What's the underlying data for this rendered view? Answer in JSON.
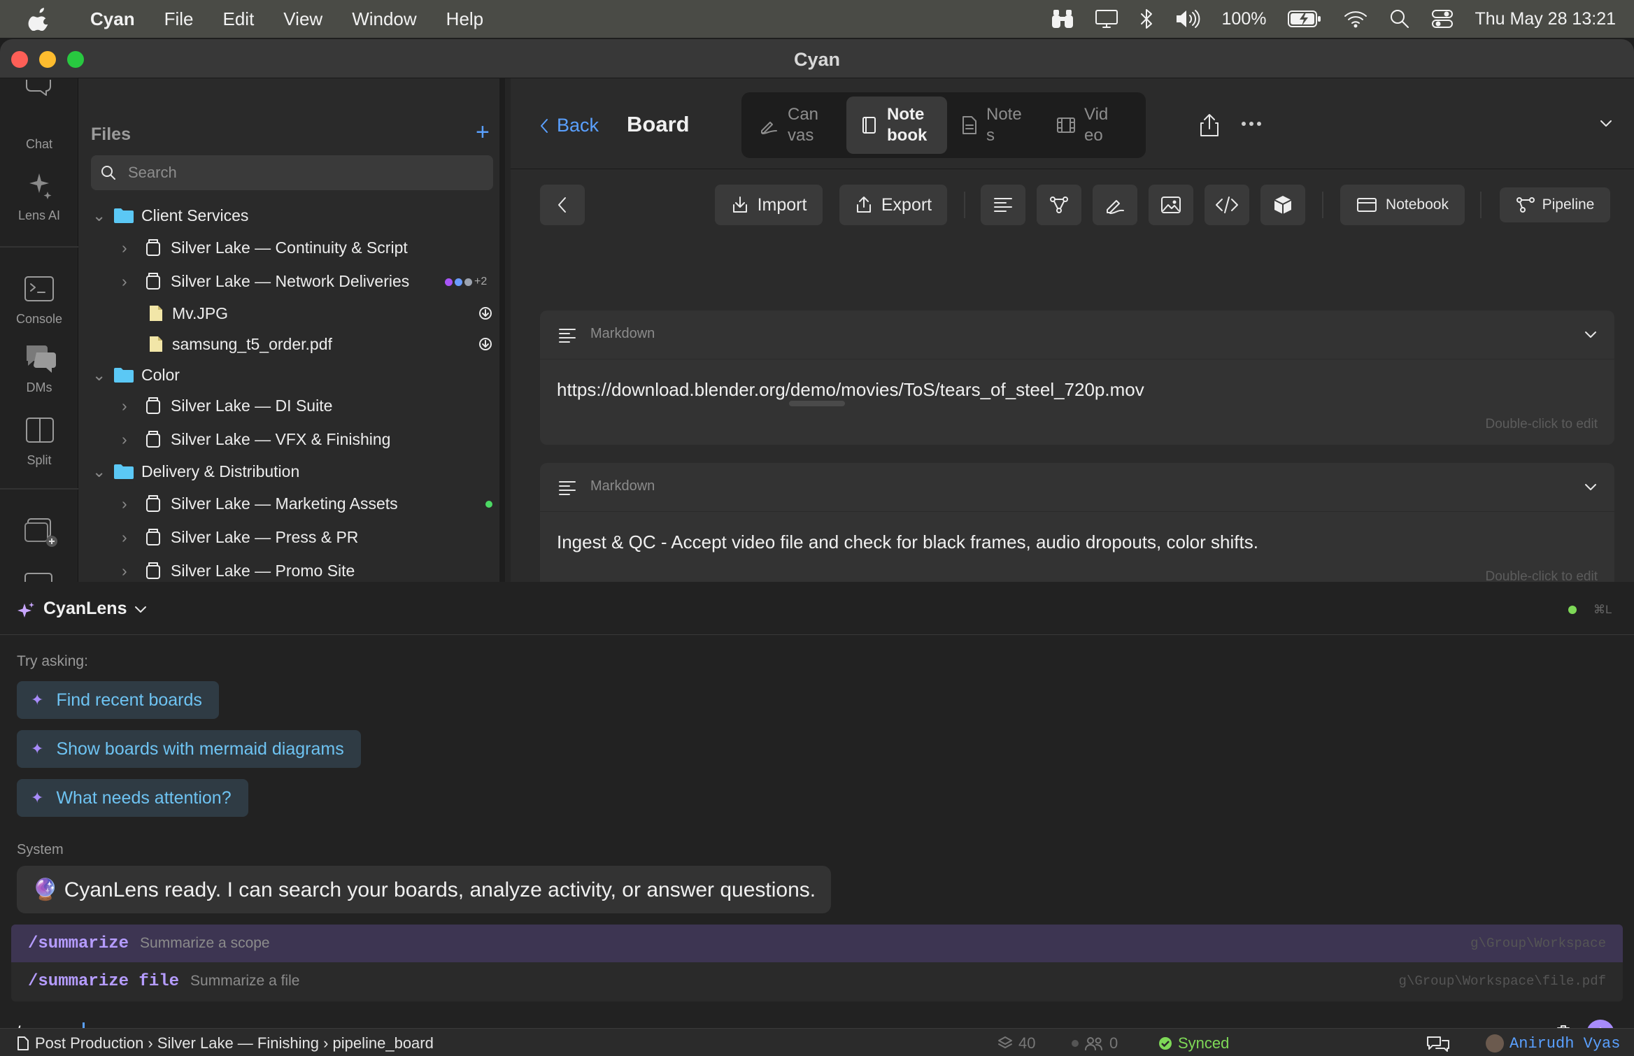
{
  "menubar": {
    "app": "Cyan",
    "items": [
      "File",
      "Edit",
      "View",
      "Window",
      "Help"
    ],
    "battery": "100%",
    "clock": "Thu May 28  13:21"
  },
  "window": {
    "title": "Cyan"
  },
  "rail": {
    "items": [
      "Chat",
      "Lens AI",
      "Console",
      "DMs",
      "Split"
    ]
  },
  "files": {
    "header": "Files",
    "search_placeholder": "Search",
    "groups": [
      {
        "name": "Client Services",
        "items": [
          "Silver Lake — Continuity & Script",
          "Silver Lake — Network Deliveries",
          "Mv.JPG",
          "samsung_t5_order.pdf"
        ]
      },
      {
        "name": "Color",
        "items": [
          "Silver Lake — DI Suite",
          "Silver Lake — VFX & Finishing"
        ]
      },
      {
        "name": "Delivery & Distribution",
        "items": [
          "Silver Lake — Marketing Assets",
          "Silver Lake — Press & PR",
          "Silver Lake — Promo Site"
        ]
      }
    ],
    "presence_more": "+2"
  },
  "topbar": {
    "back": "Back",
    "board": "Board",
    "views": [
      {
        "l1": "Can",
        "l2": "vas"
      },
      {
        "l1": "Note",
        "l2": "book"
      },
      {
        "l1": "Note",
        "l2": "s"
      },
      {
        "l1": "Vid",
        "l2": "eo"
      }
    ]
  },
  "toolbar": {
    "import": "Import",
    "export": "Export",
    "notebook": "Notebook",
    "pipeline": "Pipeline"
  },
  "cells": [
    {
      "type": "Markdown",
      "text": "https://download.blender.org/demo/movies/ToS/tears_of_steel_720p.mov",
      "hint": "Double-click to edit"
    },
    {
      "type": "Markdown",
      "text": "Ingest & QC - Accept video file and check for black frames, audio dropouts, color shifts.",
      "hint": "Double-click to edit"
    }
  ],
  "lens": {
    "name": "CyanLens",
    "shortcut": "⌘L",
    "try_label": "Try asking:",
    "suggestions": [
      "Find recent boards",
      "Show boards with mermaid diagrams",
      "What needs attention?"
    ],
    "system_label": "System",
    "system_msg": "🔮 CyanLens ready. I can search your boards, analyze activity, or answer questions.",
    "commands": [
      {
        "cmd": "/summarize",
        "desc": "Summarize a scope",
        "path": "g\\Group\\Workspace"
      },
      {
        "cmd": "/summarize file",
        "desc": "Summarize a file",
        "path": "g\\Group\\Workspace\\file.pdf"
      }
    ],
    "input": "/summa"
  },
  "status": {
    "breadcrumb": "Post Production › Silver Lake — Finishing › pipeline_board",
    "layers": "40",
    "people": "0",
    "sync": "Synced",
    "user": "Anirudh Vyas"
  },
  "colors": {
    "accent": "#5aa0ff",
    "suggestion_text": "#6ec3f2",
    "command": "#b59cff",
    "folder": "#5bc8f5",
    "synced": "#7ed957"
  }
}
